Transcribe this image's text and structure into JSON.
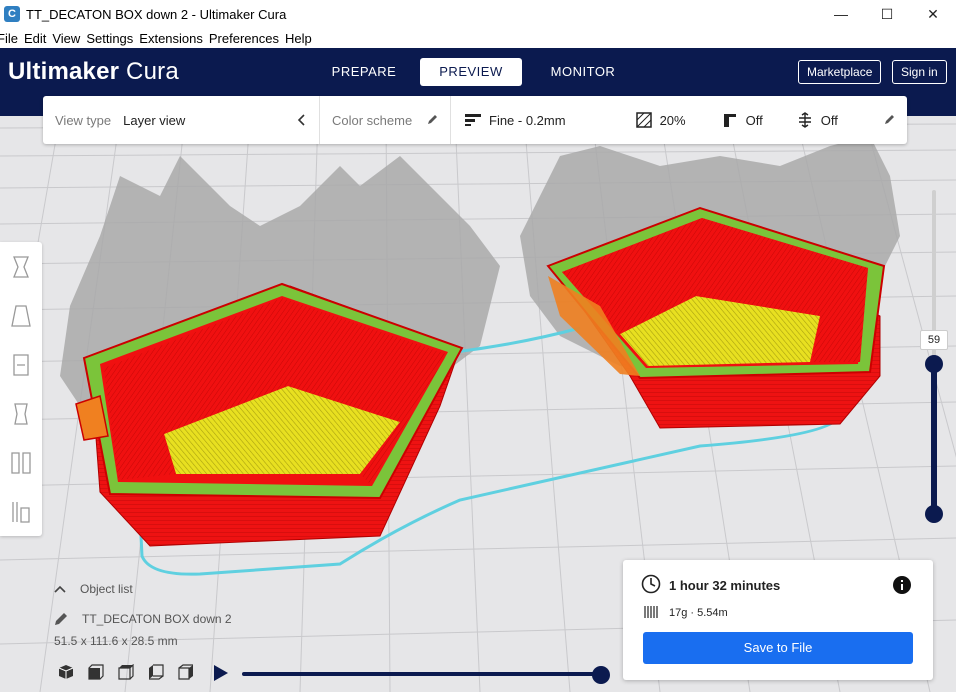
{
  "window": {
    "app_icon": "C",
    "title": "TT_DECATON BOX down 2 - Ultimaker Cura",
    "minimize": "—",
    "maximize": "☐",
    "close": "✕"
  },
  "menu": [
    "File",
    "Edit",
    "View",
    "Settings",
    "Extensions",
    "Preferences",
    "Help"
  ],
  "header": {
    "logo_bold": "Ultimaker",
    "logo_light": " Cura",
    "stages": [
      {
        "label": "PREPARE",
        "active": false
      },
      {
        "label": "PREVIEW",
        "active": true
      },
      {
        "label": "MONITOR",
        "active": false
      }
    ],
    "marketplace": "Marketplace",
    "signin": "Sign in"
  },
  "toolbar": {
    "view_type_label": "View type",
    "view_type_value": "Layer view",
    "color_scheme_label": "Color scheme",
    "profile": "Fine - 0.2mm",
    "infill": "20%",
    "support": "Off",
    "adhesion": "Off"
  },
  "layer_slider": {
    "current_layer": "59"
  },
  "object_info": {
    "list_label": "Object list",
    "object_name": "TT_DECATON BOX down 2",
    "dimensions": "51.5 x 111.6 x 28.5 mm"
  },
  "print_info": {
    "time": "1 hour 32 minutes",
    "material": "17g · 5.54m",
    "save_label": "Save to File"
  },
  "colors": {
    "header_bg": "#0b1a4f",
    "accent_button": "#196ef0",
    "model_wall": "#f01010",
    "model_infill": "#e8e020",
    "model_inner_wall": "#7bc43a",
    "travel": "#5fd0e0"
  },
  "icons": [
    "minimize-icon",
    "maximize-icon",
    "close-icon",
    "chevron-left-icon",
    "pencil-icon",
    "infill-icon",
    "support-icon",
    "adhesion-icon",
    "clock-icon",
    "info-icon",
    "spool-icon",
    "chevron-up-icon",
    "play-icon"
  ]
}
